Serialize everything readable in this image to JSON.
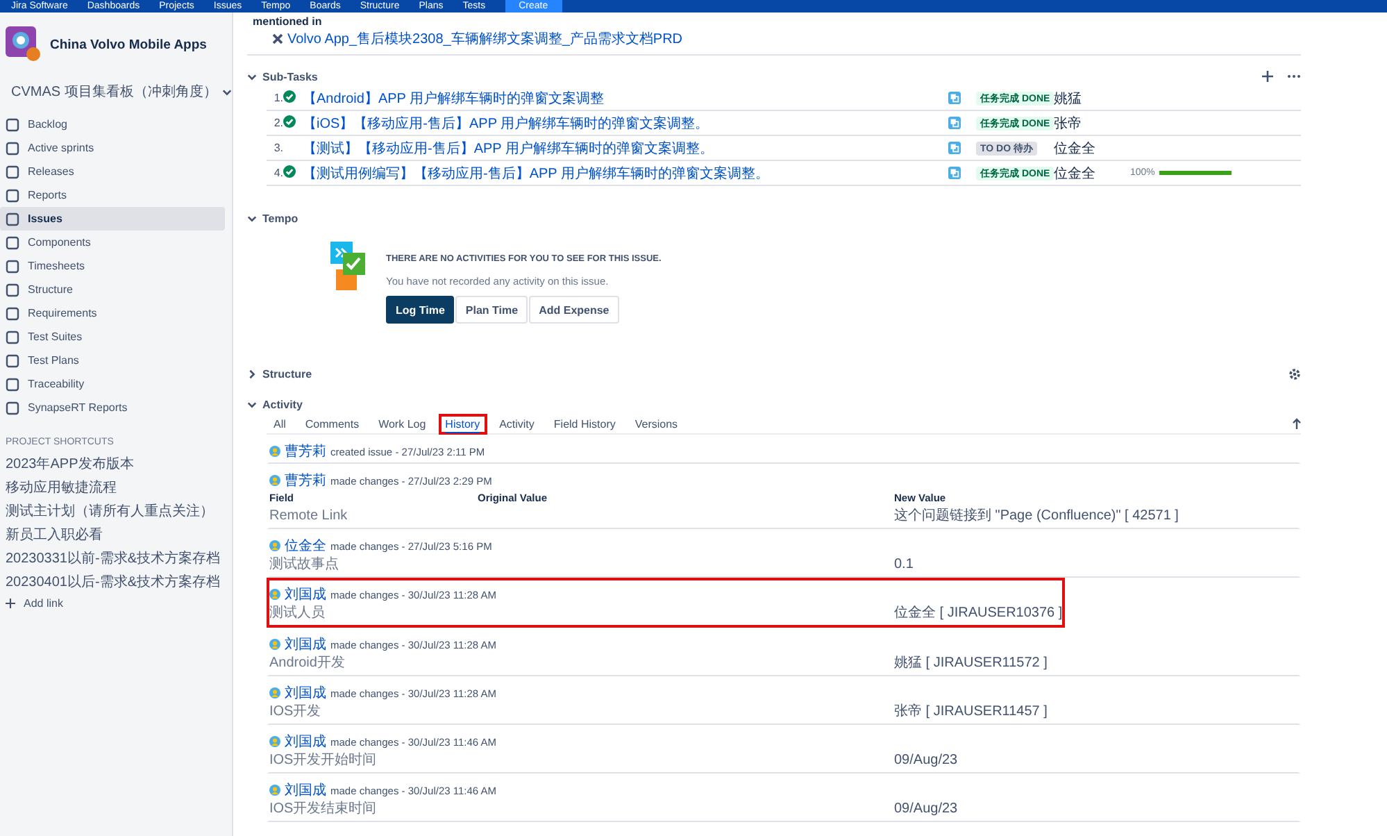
{
  "top_nav": {
    "product": "Jira Software",
    "menus": [
      "Dashboards",
      "Projects",
      "Issues",
      "Tempo",
      "Boards",
      "Structure",
      "Plans",
      "Tests"
    ],
    "create": "Create"
  },
  "sidebar": {
    "project": "China Volvo Mobile Apps",
    "board": "CVMAS 项目集看板（冲刺角度）",
    "items": [
      {
        "label": "Backlog",
        "selected": false
      },
      {
        "label": "Active sprints",
        "selected": false
      },
      {
        "label": "Releases",
        "selected": false
      },
      {
        "label": "Reports",
        "selected": false
      },
      {
        "label": "Issues",
        "selected": true
      },
      {
        "label": "Components",
        "selected": false
      },
      {
        "label": "Timesheets",
        "selected": false
      },
      {
        "label": "Structure",
        "selected": false
      },
      {
        "label": "Requirements",
        "selected": false
      },
      {
        "label": "Test Suites",
        "selected": false
      },
      {
        "label": "Test Plans",
        "selected": false
      },
      {
        "label": "Traceability",
        "selected": false
      },
      {
        "label": "SynapseRT Reports",
        "selected": false
      }
    ],
    "shortcuts_title": "PROJECT SHORTCUTS",
    "shortcuts": [
      "2023年APP发布版本",
      "移动应用敏捷流程",
      "测试主计划（请所有人重点关注）",
      "新员工入职必看",
      "20230331以前-需求&技术方案存档",
      "20230401以后-需求&技术方案存档"
    ],
    "add_link": "Add link"
  },
  "mentioned": {
    "label": "mentioned in",
    "link": "Volvo App_售后模块2308_车辆解绑文案调整_产品需求文档PRD"
  },
  "subtasks": {
    "title": "Sub-Tasks",
    "expanded": true,
    "rows": [
      {
        "number": "1.",
        "done": true,
        "summary": "【Android】APP 用户解绑车辆时的弹窗文案调整",
        "status": "任务完成 DONE",
        "assignee": "姚猛"
      },
      {
        "number": "2.",
        "done": true,
        "summary": "【iOS】【移动应用-售后】APP 用户解绑车辆时的弹窗文案调整。",
        "status": "任务完成 DONE",
        "assignee": "张帝"
      },
      {
        "number": "3.",
        "done": false,
        "summary": "【测试】【移动应用-售后】APP 用户解绑车辆时的弹窗文案调整。",
        "status": "TO DO 待办",
        "assignee": "位金全"
      },
      {
        "number": "4.",
        "done": true,
        "summary": "【测试用例编写】【移动应用-售后】APP 用户解绑车辆时的弹窗文案调整。",
        "status": "任务完成 DONE",
        "assignee": "位金全",
        "progress": "100%",
        "level": 1
      }
    ]
  },
  "tempo": {
    "title": "Tempo",
    "expanded": true,
    "heading": "THERE ARE NO ACTIVITIES FOR YOU TO SEE FOR THIS ISSUE.",
    "message": "You have not recorded any activity on this issue.",
    "buttons": [
      {
        "label": "Log Time",
        "kind": "primary"
      },
      {
        "label": "Plan Time",
        "kind": "default"
      },
      {
        "label": "Add Expense",
        "kind": "default"
      }
    ]
  },
  "structure": {
    "title": "Structure",
    "expanded": false
  },
  "activity": {
    "title": "Activity",
    "expanded": true,
    "tabs": [
      {
        "label": "All",
        "selected": false,
        "highlighted": false
      },
      {
        "label": "Comments",
        "selected": false,
        "highlighted": false
      },
      {
        "label": "Work Log",
        "selected": false,
        "highlighted": false
      },
      {
        "label": "History",
        "selected": true,
        "highlighted": true
      },
      {
        "label": "Activity",
        "selected": false,
        "highlighted": false
      },
      {
        "label": "Field History",
        "selected": false,
        "highlighted": false
      },
      {
        "label": "Versions",
        "selected": false,
        "highlighted": false
      }
    ],
    "history": [
      {
        "author": "曹芳莉",
        "action": "created issue - 27/Jul/23 2:11 PM",
        "highlighted": false
      },
      {
        "author": "曹芳莉",
        "action": "made changes - 27/Jul/23 2:29 PM",
        "highlighted": false,
        "headers": {
          "field": "Field",
          "original": "Original Value",
          "new": "New Value"
        },
        "field": "Remote Link",
        "new_value": "这个问题链接到 \"Page (Confluence)\" [ 42571 ]"
      },
      {
        "author": "位金全",
        "action": "made changes - 27/Jul/23 5:16 PM",
        "highlighted": false,
        "field": "测试故事点",
        "new_value": "0.1"
      },
      {
        "author": "刘国成",
        "action": "made changes - 30/Jul/23 11:28 AM",
        "highlighted": true,
        "field": "测试人员",
        "new_value": "位金全 [ JIRAUSER10376 ]"
      },
      {
        "author": "刘国成",
        "action": "made changes - 30/Jul/23 11:28 AM",
        "highlighted": false,
        "field": "Android开发",
        "new_value": "姚猛 [ JIRAUSER11572 ]"
      },
      {
        "author": "刘国成",
        "action": "made changes - 30/Jul/23 11:28 AM",
        "highlighted": false,
        "field": "IOS开发",
        "new_value": "张帝 [ JIRAUSER11457 ]"
      },
      {
        "author": "刘国成",
        "action": "made changes - 30/Jul/23 11:46 AM",
        "highlighted": false,
        "field": "IOS开发开始时间",
        "new_value": "09/Aug/23"
      },
      {
        "author": "刘国成",
        "action": "made changes - 30/Jul/23 11:46 AM",
        "highlighted": false,
        "field": "IOS开发结束时间",
        "new_value": "09/Aug/23"
      }
    ]
  }
}
